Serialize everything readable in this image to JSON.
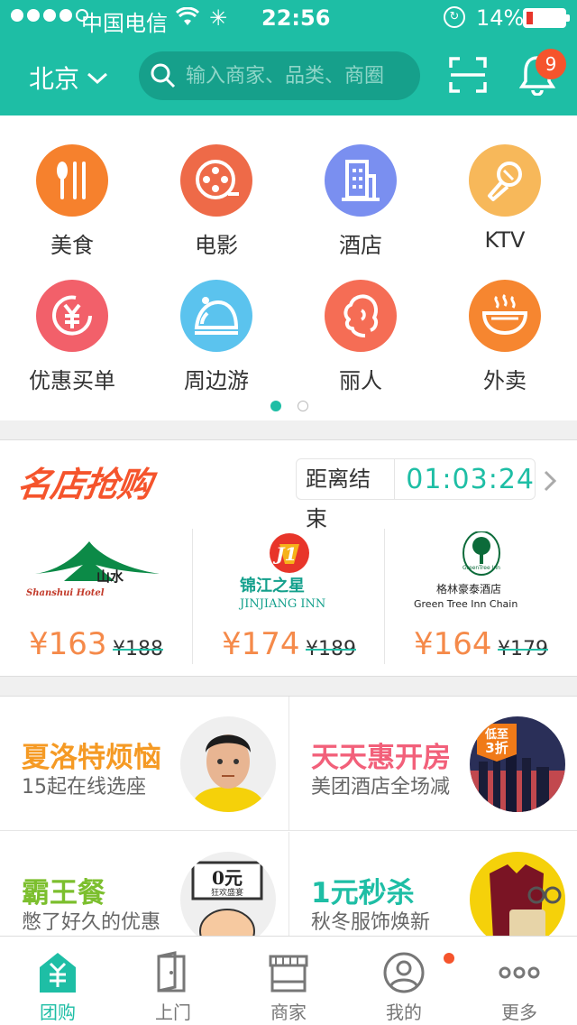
{
  "status": {
    "carrier": "中国电信",
    "time": "22:56",
    "battery": "14%"
  },
  "header": {
    "city": "北京",
    "search_placeholder": "输入商家、品类、商圈",
    "notification_count": "9",
    "accent_color": "#1ebea5"
  },
  "categories": [
    {
      "label": "美食",
      "icon": "food-icon",
      "color": "#f6812d"
    },
    {
      "label": "电影",
      "icon": "film-reel-icon",
      "color": "#ee6a48"
    },
    {
      "label": "酒店",
      "icon": "building-icon",
      "color": "#7a8ff0"
    },
    {
      "label": "KTV",
      "icon": "microphone-icon",
      "color": "#f7b85a"
    },
    {
      "label": "优惠买单",
      "icon": "yuan-icon",
      "color": "#f2606a"
    },
    {
      "label": "周边游",
      "icon": "travel-icon",
      "color": "#5bc3ee"
    },
    {
      "label": "丽人",
      "icon": "beauty-icon",
      "color": "#f56d55"
    },
    {
      "label": "外卖",
      "icon": "bowl-icon",
      "color": "#f68630"
    }
  ],
  "page_dots": {
    "total": 2,
    "active": 0
  },
  "flash_sale": {
    "title": "名店抢购",
    "countdown_label": "距离结束",
    "countdown": "01:03:24",
    "deals": [
      {
        "brand_cn": "山水",
        "brand_en": "Shanshui Hotel",
        "price": "¥163",
        "original": "¥188"
      },
      {
        "brand_cn": "锦江之星",
        "brand_en": "JINJIANG INN",
        "price": "¥174",
        "original": "¥189"
      },
      {
        "brand_cn": "格林豪泰酒店",
        "brand_en": "Green Tree Inn Chain",
        "logo_text": "GreenTree Inn",
        "price": "¥164",
        "original": "¥179"
      }
    ]
  },
  "promos": [
    {
      "title": "夏洛特烦恼",
      "subtitle": "15起在线选座",
      "color": "#f59a24"
    },
    {
      "title": "天天惠开房",
      "subtitle": "美团酒店全场减",
      "color": "#f2607a",
      "badge_line1": "低至",
      "badge_line2": "3折"
    },
    {
      "title": "霸王餐",
      "subtitle": "憋了好久的优惠",
      "color": "#7cbf2e",
      "sign_line1": "0元",
      "sign_line2": "狂欢盛宴"
    },
    {
      "title": "1元秒杀",
      "subtitle": "秋冬服饰焕新",
      "color": "#1ebea5"
    }
  ],
  "tabs": [
    {
      "label": "团购",
      "icon": "group-buy-icon",
      "active": true
    },
    {
      "label": "上门",
      "icon": "door-icon",
      "active": false
    },
    {
      "label": "商家",
      "icon": "store-icon",
      "active": false
    },
    {
      "label": "我的",
      "icon": "profile-icon",
      "active": false
    },
    {
      "label": "更多",
      "icon": "more-icon",
      "active": false
    }
  ]
}
